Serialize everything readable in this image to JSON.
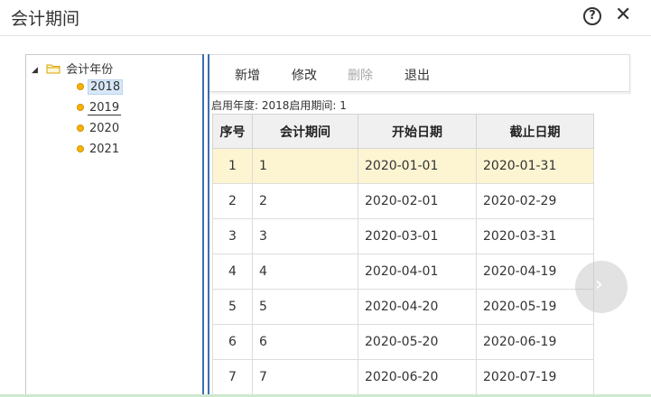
{
  "window": {
    "title": "会计期间",
    "help_icon": "question-circle-icon",
    "close_icon": "close-icon",
    "help_glyph": "?",
    "close_glyph": "✕"
  },
  "tree": {
    "root_label": "会计年份",
    "root_icon": "folder-icon",
    "items": [
      {
        "label": "2018",
        "selected": true
      },
      {
        "label": "2019",
        "selected": false
      },
      {
        "label": "2020",
        "selected": false
      },
      {
        "label": "2021",
        "selected": false
      }
    ]
  },
  "toolbar": {
    "add_label": "新增",
    "edit_label": "修改",
    "delete_label": "删除",
    "exit_label": "退出"
  },
  "info": {
    "text": "启用年度:  2018启用期间:  1"
  },
  "table": {
    "headers": [
      "序号",
      "会计期间",
      "开始日期",
      "截止日期"
    ],
    "rows": [
      [
        "1",
        "1",
        "2020-01-01",
        "2020-01-31"
      ],
      [
        "2",
        "2",
        "2020-02-01",
        "2020-02-29"
      ],
      [
        "3",
        "3",
        "2020-03-01",
        "2020-03-31"
      ],
      [
        "4",
        "4",
        "2020-04-01",
        "2020-04-19"
      ],
      [
        "5",
        "5",
        "2020-04-20",
        "2020-05-19"
      ],
      [
        "6",
        "6",
        "2020-05-20",
        "2020-06-19"
      ],
      [
        "7",
        "7",
        "2020-06-20",
        "2020-07-19"
      ]
    ],
    "selected_row": 0
  },
  "next_button": {
    "icon": "chevron-right-icon",
    "glyph": "›"
  },
  "colors": {
    "selected_row_bg": "#fdf4d2",
    "splitter": "#3c6fb5",
    "tree_dot": "#f5b400"
  }
}
